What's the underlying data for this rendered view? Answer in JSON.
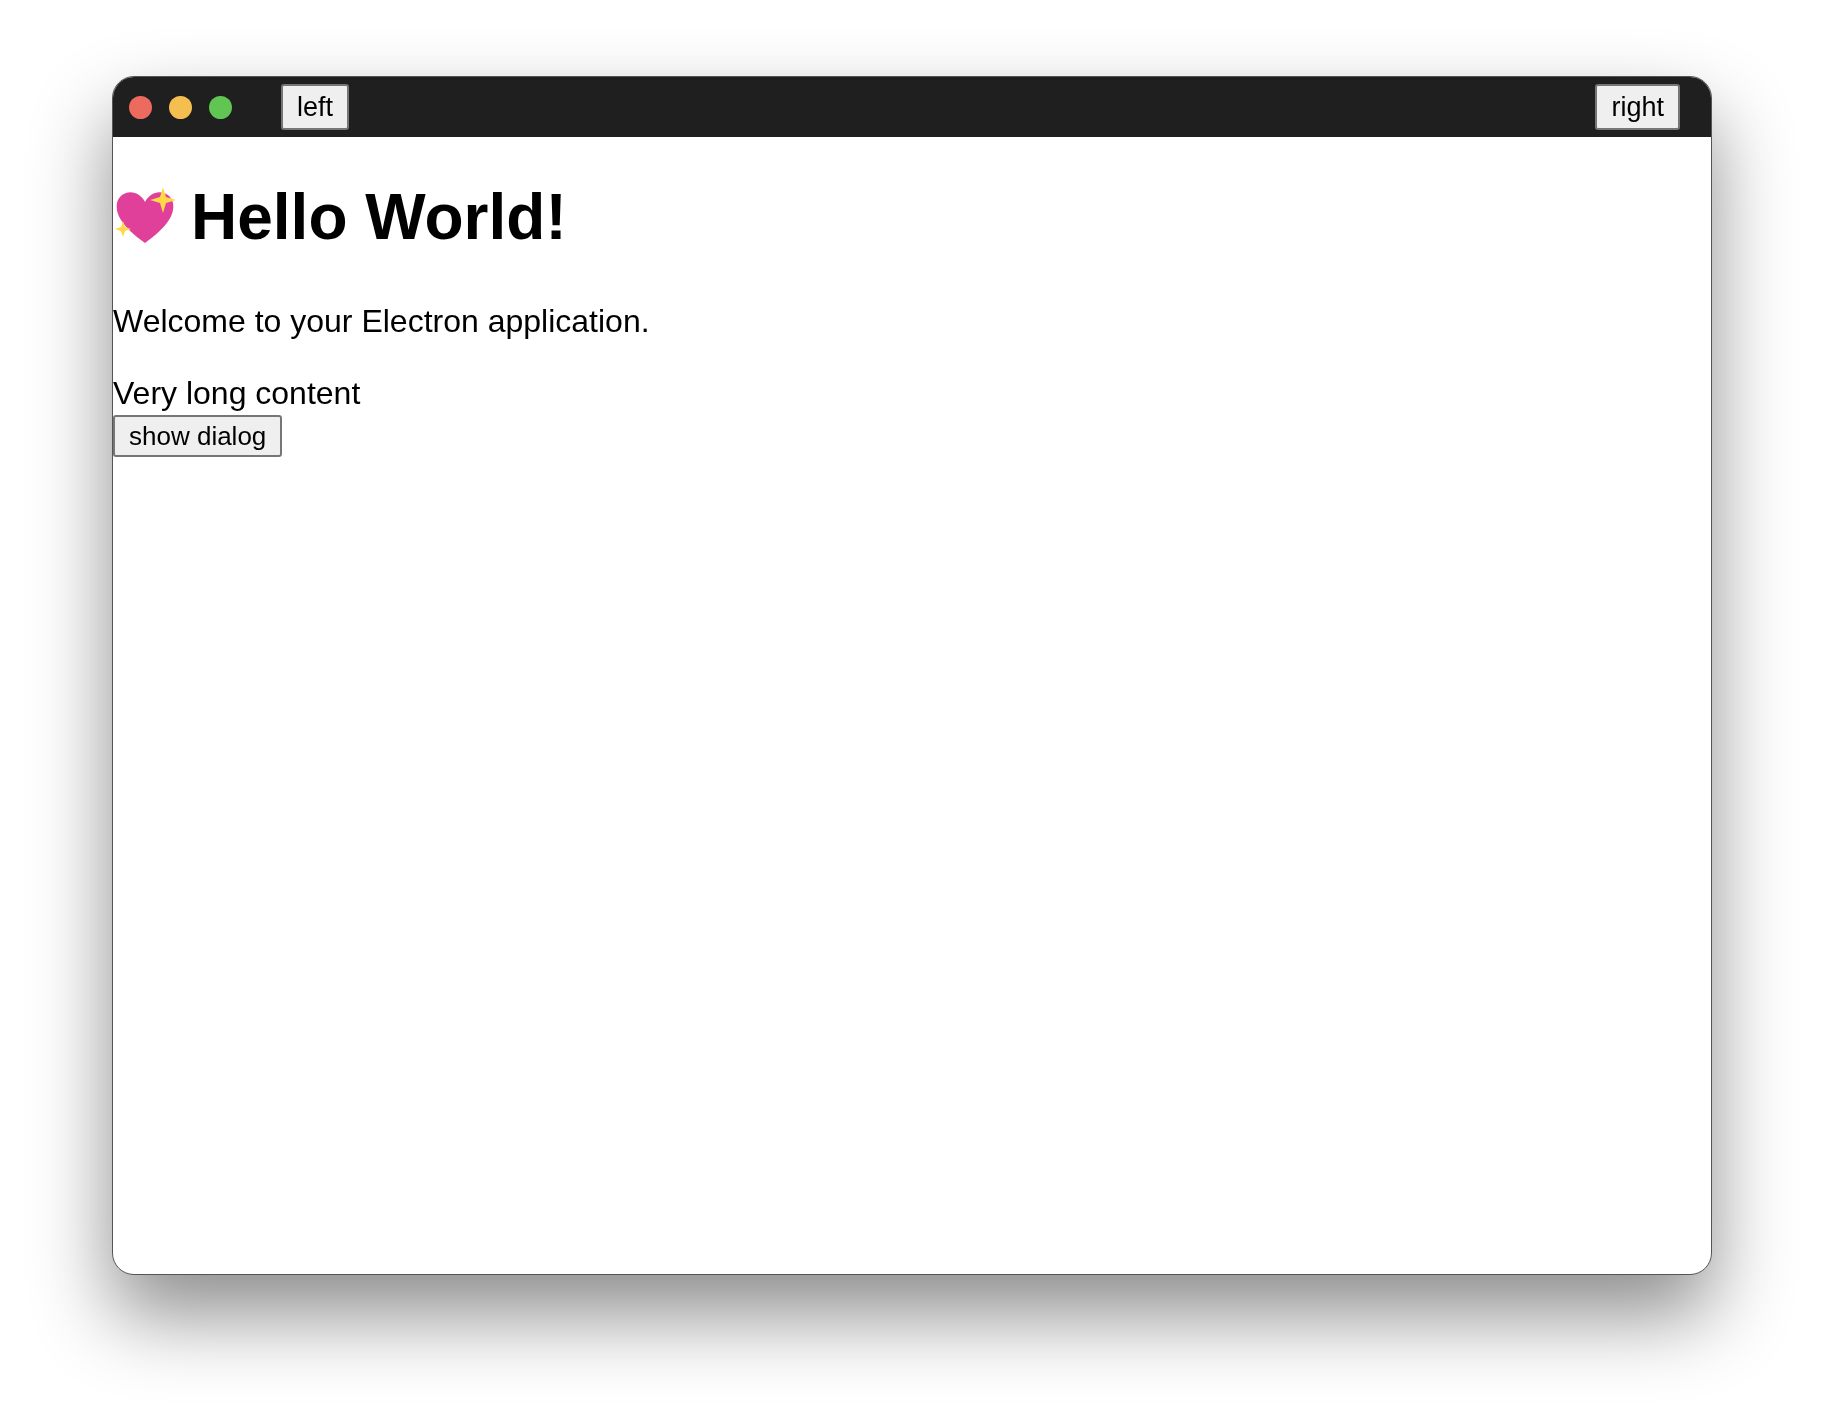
{
  "titlebar": {
    "left_button": "left",
    "right_button": "right"
  },
  "content": {
    "heading": "Hello World!",
    "welcome": "Welcome to your Electron application.",
    "long_content": "Very long content",
    "dialog_button": "show dialog"
  }
}
